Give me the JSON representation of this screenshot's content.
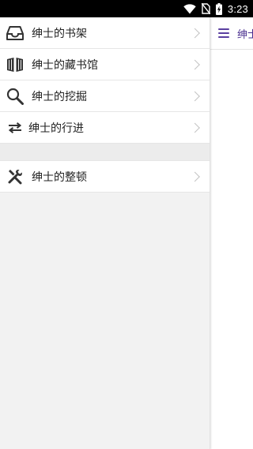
{
  "status_bar": {
    "time": "3:23",
    "icons": [
      "wifi-icon",
      "no-sim-icon",
      "battery-charging-icon"
    ]
  },
  "main": {
    "title": "绅士"
  },
  "drawer": {
    "items": [
      {
        "label": "绅士的书架",
        "icon": "inbox-tray-icon"
      },
      {
        "label": "绅士的藏书馆",
        "icon": "books-icon"
      },
      {
        "label": "绅士的挖掘",
        "icon": "search-icon"
      },
      {
        "label": "绅士的行进",
        "icon": "swap-arrows-icon"
      }
    ],
    "secondary_items": [
      {
        "label": "绅士的整顿",
        "icon": "tools-icon"
      }
    ]
  },
  "colors": {
    "accent": "#4a2f8f",
    "menu_bg": "#ffffff",
    "drawer_bg": "#f2f2f2",
    "status_bg": "#000000"
  }
}
